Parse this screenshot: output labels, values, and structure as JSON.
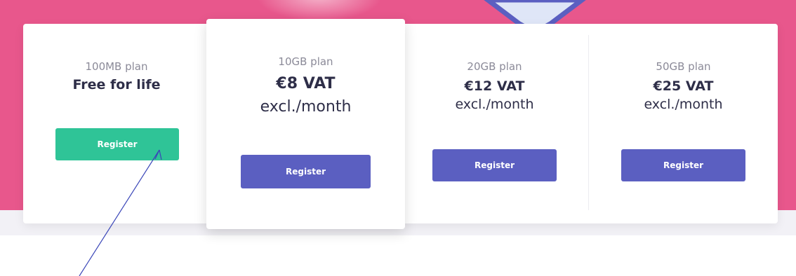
{
  "plans": [
    {
      "name": "100MB plan",
      "price_line1": "Free for life",
      "price_line2": "",
      "button": "Register",
      "button_color": "#2fc497"
    },
    {
      "name": "10GB plan",
      "price_line1": "€8 VAT",
      "price_line2": "excl./month",
      "button": "Register",
      "button_color": "#5b5fc1",
      "featured": true
    },
    {
      "name": "20GB plan",
      "price_line1": "€12 VAT",
      "price_line2": "excl./month",
      "button": "Register",
      "button_color": "#5b5fc1"
    },
    {
      "name": "50GB plan",
      "price_line1": "€25 VAT",
      "price_line2": "excl./month",
      "button": "Register",
      "button_color": "#5b5fc1"
    }
  ],
  "colors": {
    "hero": "#e8578c",
    "accent_green": "#2fc497",
    "accent_purple": "#5b5fc1",
    "annotation_arrow": "#3a46b8"
  },
  "annotation": {
    "icon": "arrow-icon",
    "points_to": "100MB plan register button"
  }
}
